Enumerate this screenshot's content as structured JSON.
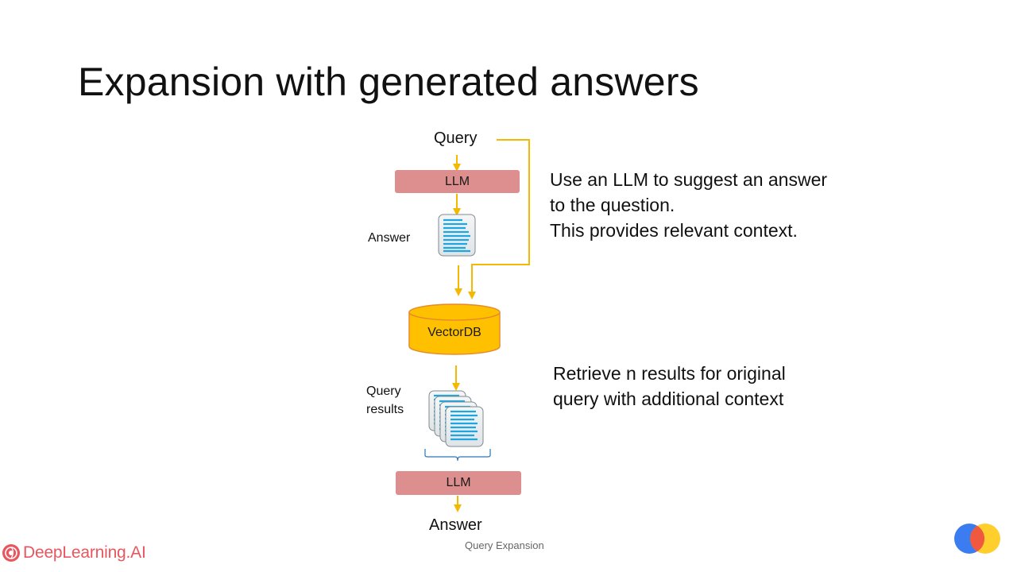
{
  "slide": {
    "title": "Expansion with generated answers",
    "footer_caption": "Query Expansion"
  },
  "brand": {
    "name": "DeepLearning.AI",
    "logo_icon": "deeplearning-ai-logo-icon",
    "corner_icon": "overlapping-circles-icon"
  },
  "diagram": {
    "query_label": "Query",
    "llm_top_label": "LLM",
    "answer_label": "Answer",
    "vectordb_label": "VectorDB",
    "query_results_label_line1": "Query",
    "query_results_label_line2": "results",
    "llm_bottom_label": "LLM",
    "final_answer_label": "Answer"
  },
  "annotations": {
    "step1": [
      "Use an LLM to suggest an answer",
      "to the question.",
      "This provides relevant context."
    ],
    "step2": [
      "Retrieve n results for original",
      "query with additional context"
    ]
  },
  "colors": {
    "arrow": "#f5b800",
    "llm_box": "#dd8e8e",
    "vectordb": "#ffc000",
    "document_lines": "#1ea6e0",
    "brand": "#e8565f",
    "circle_blue": "#3b7df0",
    "circle_yellow": "#ffcf2e",
    "circle_red": "#f0583f"
  }
}
